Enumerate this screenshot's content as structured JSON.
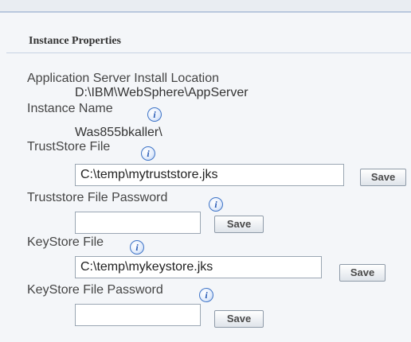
{
  "section": {
    "title": "Instance Properties"
  },
  "fields": {
    "app_server_location": {
      "label": "Application Server Install Location",
      "value": "D:\\IBM\\WebSphere\\AppServer"
    },
    "instance_name": {
      "label": "Instance Name",
      "value": "Was855bkaller\\"
    },
    "truststore_file": {
      "label": "TrustStore File",
      "value": "C:\\temp\\mytruststore.jks"
    },
    "truststore_password": {
      "label": "Truststore File Password",
      "value": ""
    },
    "keystore_file": {
      "label": "KeyStore File",
      "value": "C:\\temp\\mykeystore.jks"
    },
    "keystore_password": {
      "label": "KeyStore File Password",
      "value": ""
    }
  },
  "buttons": {
    "save": "Save"
  },
  "icons": {
    "info": "info-icon"
  }
}
